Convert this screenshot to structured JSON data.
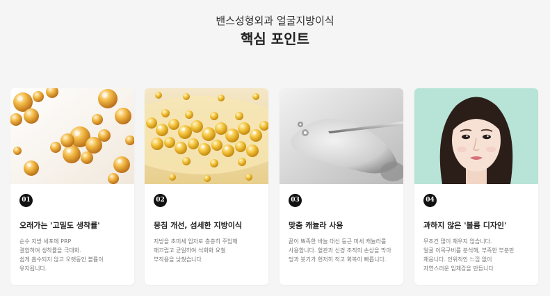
{
  "header": {
    "subtitle": "밴스성형외과 얼굴지방이식",
    "title": "핵심 포인트"
  },
  "cards": [
    {
      "number": "01",
      "title": "오래가는 '고밀도 생착률'",
      "desc": [
        "순수 지방 세포에 PRP",
        "결합하여 생착률을 극대화.",
        "쉽게 흡수되지 않고 오랫동안 볼륨이",
        "유지됩니다."
      ],
      "image": "fat-cells-image"
    },
    {
      "number": "02",
      "title": "뭉침 개선, 섬세한 지방이식",
      "desc": [
        "지방을 초미세 입자로 층층히 주입해",
        "매끄럽고 균일하여 석회화 요철",
        "부작용을 낮췄습니다"
      ],
      "image": "micro-fat-particles-image"
    },
    {
      "number": "03",
      "title": "맞춤 캐뉼라 사용",
      "desc": [
        "끝이 뾰족한 바늘 대신 둥근 미세 캐뉼라를",
        "사용합니다. 혈관과 신경 조직의 손상을 막아",
        "멍과 붓기가 현저히 적고 회복이 빠릅니다."
      ],
      "image": "cannula-image"
    },
    {
      "number": "04",
      "title": "과하지 않은 '볼륨 디자인'",
      "desc": [
        "무조건 많이 채우지 않습니다.",
        "얼굴 이목구비를 분석해, 부족한 부분만",
        "채웁니다. 인위적인 느낌 없이",
        "자연스러운 입체감을 만듭니다"
      ],
      "image": "model-face-image"
    }
  ]
}
